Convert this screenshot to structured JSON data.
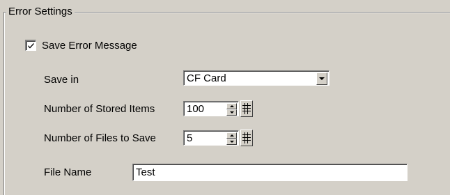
{
  "group": {
    "title": "Error Settings"
  },
  "save_error": {
    "label": "Save Error Message",
    "checked": true
  },
  "save_in": {
    "label": "Save in",
    "value": "CF Card"
  },
  "stored_items": {
    "label": "Number of Stored Items",
    "value": "100"
  },
  "files_to_save": {
    "label": "Number of Files to Save",
    "value": "5"
  },
  "file_name": {
    "label": "File Name",
    "value": "Test"
  },
  "icons": {
    "checkbox": "check-icon",
    "dropdown": "chevron-down-icon",
    "spinner": "spin-arrows-icon",
    "keypad": "keypad-icon"
  }
}
